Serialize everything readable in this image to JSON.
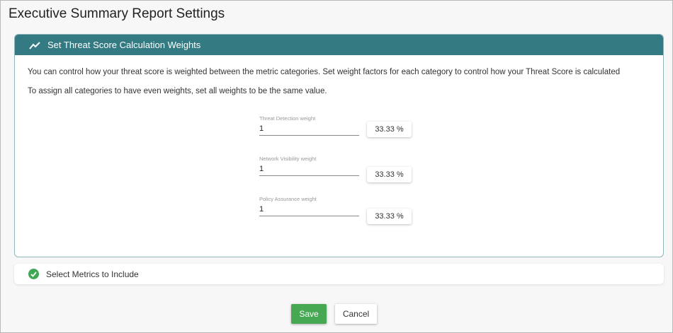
{
  "page_title": "Executive Summary Report Settings",
  "weights_panel": {
    "header": "Set Threat Score Calculation Weights",
    "icon": "trend-line-icon",
    "description1": "You can control how your threat score is weighted between the metric categories. Set weight factors for each category to control how your Threat Score is calculated",
    "description2": "To assign all categories to have even weights, set all weights to be the same value.",
    "fields": [
      {
        "label": "Threat Detection weight",
        "value": "1",
        "percent": "33.33 %"
      },
      {
        "label": "Network Visibility weight",
        "value": "1",
        "percent": "33.33 %"
      },
      {
        "label": "Policy Assurance weight",
        "value": "1",
        "percent": "33.33 %"
      }
    ]
  },
  "metrics_panel": {
    "header": "Select Metrics to Include",
    "icon": "check-circle-icon",
    "color": "#3ea952"
  },
  "buttons": {
    "save": "Save",
    "cancel": "Cancel"
  },
  "colors": {
    "header": "#337a83",
    "save": "#46a853"
  }
}
